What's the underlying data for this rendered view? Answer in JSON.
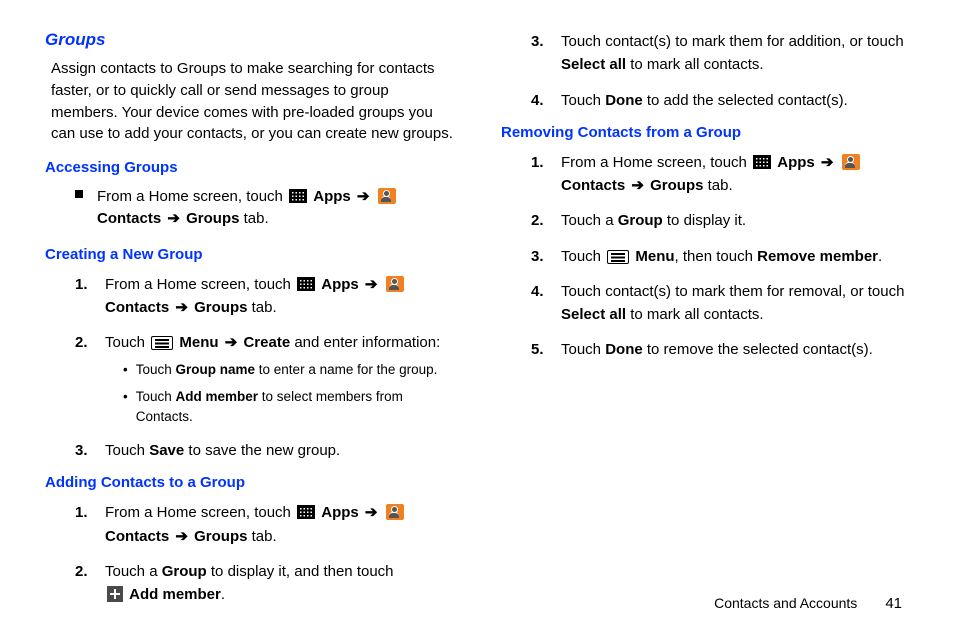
{
  "sectionTitle": "Groups",
  "intro": "Assign contacts to Groups to make searching for contacts faster, or to quickly call or send messages to group members. Your device comes with pre-loaded groups you can use to add your contacts, or you can create new groups.",
  "accessing": {
    "title": "Accessing Groups",
    "fromHome": "From a Home screen, touch ",
    "apps": "Apps",
    "contacts": "Contacts",
    "groupsTab": "Groups",
    "tabWord": " tab."
  },
  "creating": {
    "title": "Creating a New Group",
    "step1_pre": "From a Home screen, touch ",
    "step2_pre": "Touch ",
    "step2_menu": "Menu",
    "step2_create": "Create",
    "step2_post": " and enter information:",
    "sub1_pre": "Touch ",
    "sub1_bold": "Group name",
    "sub1_post": " to enter a name for the group.",
    "sub2_pre": "Touch ",
    "sub2_bold": "Add member",
    "sub2_post": " to select members from Contacts.",
    "step3_pre": "Touch ",
    "step3_bold": "Save",
    "step3_post": " to save the new group."
  },
  "adding": {
    "title": "Adding Contacts to a Group",
    "step2_pre": "Touch a ",
    "step2_bold1": "Group",
    "step2_mid": " to display it, and then touch ",
    "step2_bold2": "Add member",
    "step2_post": ".",
    "step3_pre": "Touch contact(s) to mark them for addition, or touch ",
    "step3_bold": "Select all",
    "step3_post": " to mark all contacts.",
    "step4_pre": "Touch ",
    "step4_bold": "Done",
    "step4_post": " to add the selected contact(s)."
  },
  "removing": {
    "title": "Removing Contacts from a Group",
    "step2_pre": "Touch a ",
    "step2_bold": "Group",
    "step2_post": " to display it.",
    "step3_pre": "Touch ",
    "step3_menu": "Menu",
    "step3_mid": ", then touch ",
    "step3_bold": "Remove member",
    "step3_post": ".",
    "step4_pre": "Touch contact(s) to mark them for removal, or touch ",
    "step4_bold": "Select all",
    "step4_post": " to mark all contacts.",
    "step5_pre": "Touch ",
    "step5_bold": "Done",
    "step5_post": " to remove the selected contact(s)."
  },
  "footer": {
    "chapter": "Contacts and Accounts",
    "page": "41"
  },
  "arrow": "➔"
}
